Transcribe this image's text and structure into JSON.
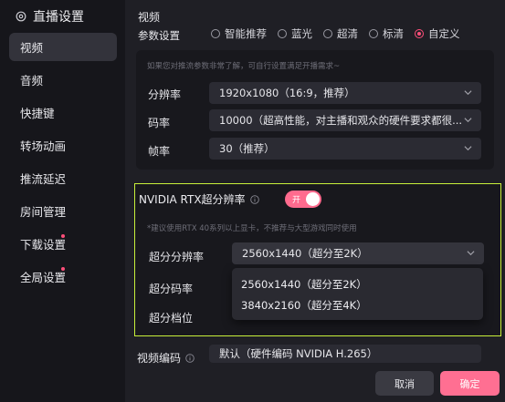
{
  "app": {
    "title": "直播设置"
  },
  "sidebar": {
    "items": [
      {
        "label": "视频",
        "active": true
      },
      {
        "label": "音频"
      },
      {
        "label": "快捷键"
      },
      {
        "label": "转场动画"
      },
      {
        "label": "推流延迟"
      },
      {
        "label": "房间管理"
      },
      {
        "label": "下载设置",
        "dot": true
      },
      {
        "label": "全局设置",
        "dot": true
      }
    ]
  },
  "video": {
    "section_title": "视频",
    "param_label": "参数设置",
    "presets": [
      "智能推荐",
      "蓝光",
      "超清",
      "标清",
      "自定义"
    ],
    "selected_preset": "自定义",
    "hint": "如果您对推流参数非常了解，可自行设置满足开播需求~",
    "resolution": {
      "label": "分辨率",
      "value": "1920x1080（16:9，推荐）"
    },
    "bitrate": {
      "label": "码率",
      "value": "10000（超高性能，对主播和观众的硬件要求都很..."
    },
    "framerate": {
      "label": "帧率",
      "value": "30（推荐）"
    }
  },
  "rtx": {
    "title": "NVIDIA RTX超分辨率",
    "toggle_label": "开",
    "toggle_on": true,
    "hint": "*建议使用RTX 40系列以上显卡，不推荐与大型游戏同时使用",
    "sr_resolution": {
      "label": "超分分辨率",
      "value": "2560x1440（超分至2K）"
    },
    "sr_bitrate_label": "超分码率",
    "sr_level_label": "超分档位",
    "dropdown_options": [
      "2560x1440（超分至2K）",
      "3840x2160（超分至4K）"
    ]
  },
  "encoding": {
    "label": "视频编码",
    "value": "默认（硬件编码 NVIDIA H.265）"
  },
  "buttons": {
    "cancel": "取消",
    "confirm": "确定"
  },
  "colors": {
    "accent": "#ff6f92",
    "highlight_border": "#c8f03a",
    "bg": "#1f1f25"
  }
}
